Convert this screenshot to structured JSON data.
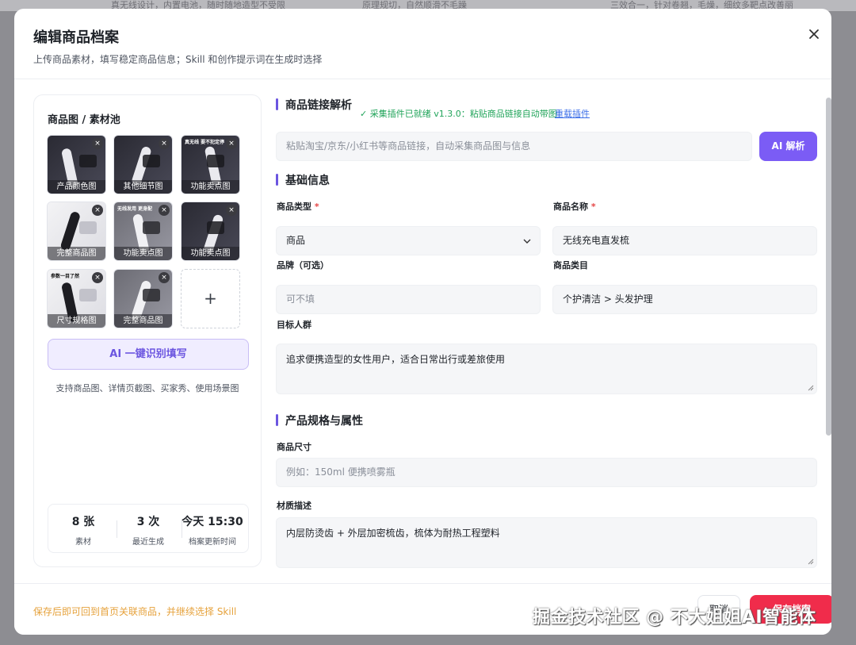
{
  "background": {
    "snippets": [
      "真无线设计，内置电池，随时随地造型不受限",
      "原理规切，自然顺滑不毛躁",
      "三效合一，针对卷翘，毛燥，细纹多靶点改善丽"
    ]
  },
  "modal": {
    "title": "编辑商品档案",
    "subtitle": "上传商品素材，填写稳定商品信息；Skill 和创作提示词在生成时选择"
  },
  "assets": {
    "title": "商品图 / 素材池",
    "thumbs": [
      {
        "label": "产品颜色图",
        "style": "dark"
      },
      {
        "label": "其他细节图",
        "style": "dark"
      },
      {
        "label": "功能卖点图",
        "style": "dark",
        "caption": "真无线 要不犯定停"
      },
      {
        "label": "完整商品图",
        "style": "light"
      },
      {
        "label": "功能卖点图",
        "style": "grey",
        "caption": "无线发用 更身配"
      },
      {
        "label": "功能卖点图",
        "style": "dark"
      },
      {
        "label": "尺寸规格图",
        "style": "light",
        "caption": "参数一目了然"
      },
      {
        "label": "完整商品图",
        "style": "grey"
      }
    ],
    "remove_symbol": "×",
    "add_symbol": "+",
    "ai_fill_label": "AI 一键识别填写",
    "support_text": "支持商品图、详情页截图、买家秀、使用场景图",
    "stats": [
      {
        "value": "8 张",
        "label": "素材"
      },
      {
        "value": "3 次",
        "label": "最近生成"
      },
      {
        "value": "今天 15:30",
        "label": "档案更新时间"
      }
    ]
  },
  "link_section": {
    "title": "商品链接解析",
    "plugin_status": "✓ 采集插件已就绪 v1.3.0：粘贴商品链接自动带图",
    "reload_label": "重载插件",
    "link_placeholder": "粘贴淘宝/京东/小红书等商品链接，自动采集商品图与信息",
    "parse_label": "AI 解析"
  },
  "basic_section": {
    "title": "基础信息",
    "type_label": "商品类型",
    "type_value": "商品",
    "name_label": "商品名称",
    "name_value": "无线充电直发梳",
    "brand_label": "品牌（可选）",
    "brand_placeholder": "可不填",
    "category_label": "商品类目",
    "category_value": "个护清洁 > 头发护理",
    "audience_label": "目标人群",
    "audience_value": "追求便携造型的女性用户，适合日常出行或差旅使用",
    "required_mark": "*"
  },
  "spec_section": {
    "title": "产品规格与属性",
    "size_label": "商品尺寸",
    "size_placeholder": "例如：150ml 便携喷雾瓶",
    "material_label": "材质描述",
    "material_value": "内层防烫齿 + 外层加密梳齿，梳体为耐热工程塑料"
  },
  "footer": {
    "hint": "保存后即可回到首页关联商品，并继续选择 Skill",
    "cancel_label": "取消",
    "save_label": "保存档案"
  },
  "watermark": "掘金技术社区 @ 不大姐姐AI智能体",
  "colors": {
    "accent": "#6b55e0",
    "parse_button": "#7b5cf5",
    "save_button": "#f02c4b",
    "status_green": "#21a45a",
    "hint_orange": "#e6a23c"
  }
}
